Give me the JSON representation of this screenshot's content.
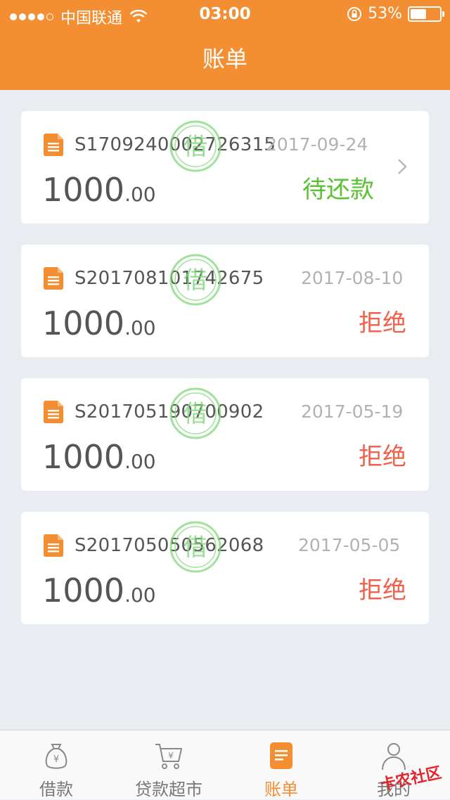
{
  "status_bar": {
    "carrier": "中国联通",
    "time": "03:00",
    "battery": "53%"
  },
  "nav": {
    "title": "账单"
  },
  "stamp_char": "借",
  "bills": [
    {
      "order_no": "S1709240002726315",
      "date": "2017-09-24",
      "amount_int": "1000",
      "amount_dec": ".00",
      "status": "待还款",
      "status_color": "#5ac230",
      "has_arrow": true
    },
    {
      "order_no": "S201708101742675",
      "date": "2017-08-10",
      "amount_int": "1000",
      "amount_dec": ".00",
      "status": "拒绝",
      "status_color": "#f0604a",
      "has_arrow": false
    },
    {
      "order_no": "S201705190700902",
      "date": "2017-05-19",
      "amount_int": "1000",
      "amount_dec": ".00",
      "status": "拒绝",
      "status_color": "#f0604a",
      "has_arrow": false
    },
    {
      "order_no": "S201705050562068",
      "date": "2017-05-05",
      "amount_int": "1000",
      "amount_dec": ".00",
      "status": "拒绝",
      "status_color": "#f0604a",
      "has_arrow": false
    }
  ],
  "tabs": [
    {
      "label": "借款",
      "icon": "money-bag-icon",
      "active": false
    },
    {
      "label": "贷款超市",
      "icon": "shopping-cart-icon",
      "active": false
    },
    {
      "label": "账单",
      "icon": "bill-document-icon",
      "active": true
    },
    {
      "label": "我的",
      "icon": "user-icon",
      "active": false
    }
  ],
  "watermark": "卡农社区",
  "colors": {
    "brand": "#f48e33",
    "pending": "#5ac230",
    "rejected": "#f0604a",
    "background": "#e9edf1"
  }
}
